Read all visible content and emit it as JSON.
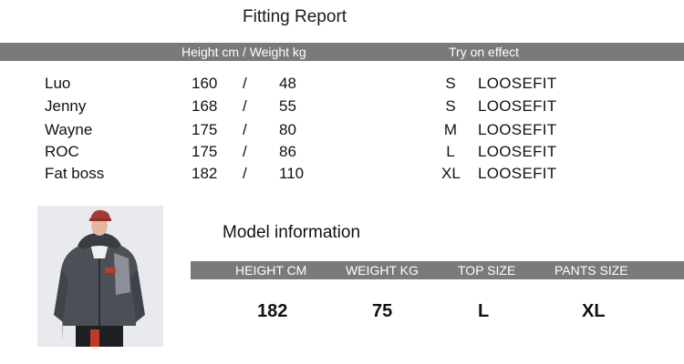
{
  "fitting_report": {
    "title": "Fitting Report",
    "header_left": "Height cm / Weight kg",
    "header_right": "Try on effect",
    "separator": "/",
    "rows": [
      {
        "name": "Luo",
        "height": "160",
        "weight": "48",
        "size": "S",
        "fit": "LOOSEFIT"
      },
      {
        "name": "Jenny",
        "height": "168",
        "weight": "55",
        "size": "S",
        "fit": "LOOSEFIT"
      },
      {
        "name": "Wayne",
        "height": "175",
        "weight": "80",
        "size": "M",
        "fit": "LOOSEFIT"
      },
      {
        "name": "ROC",
        "height": "175",
        "weight": "86",
        "size": "L",
        "fit": "LOOSEFIT"
      },
      {
        "name": "Fat boss",
        "height": "182",
        "weight": "110",
        "size": "XL",
        "fit": "LOOSEFIT"
      }
    ]
  },
  "model_information": {
    "title": "Model information",
    "headers": [
      "HEIGHT CM",
      "WEIGHT KG",
      "TOP SIZE",
      "PANTS SIZE"
    ],
    "values": [
      "182",
      "75",
      "L",
      "XL"
    ]
  },
  "colors": {
    "header_bar": "#7a7a7a",
    "jacket": "#4b4f56",
    "accent": "#c0392b"
  }
}
